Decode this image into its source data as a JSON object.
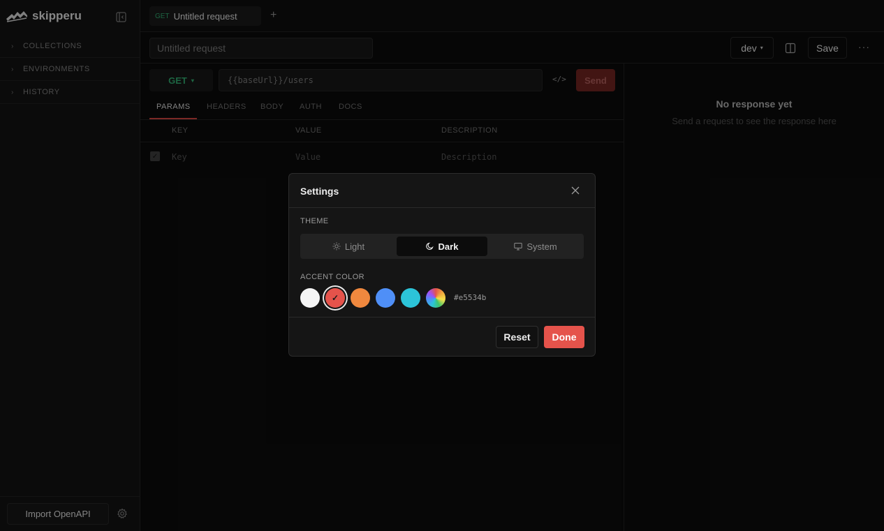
{
  "app": {
    "name": "skipperu"
  },
  "sidebar": {
    "items": [
      {
        "label": "COLLECTIONS"
      },
      {
        "label": "ENVIRONMENTS"
      },
      {
        "label": "HISTORY"
      }
    ],
    "import_label": "Import OpenAPI"
  },
  "tabs": [
    {
      "method": "GET",
      "label": "Untitled request"
    }
  ],
  "add_tab_glyph": "+",
  "request": {
    "name_placeholder": "Untitled request",
    "environment": "dev",
    "save_label": "Save",
    "more_glyph": "···",
    "method": "GET",
    "url_placeholder": "{{baseUrl}}/users",
    "code_glyph": "</>",
    "send_label": "Send"
  },
  "subtabs": [
    {
      "label": "PARAMS",
      "active": true
    },
    {
      "label": "HEADERS"
    },
    {
      "label": "BODY"
    },
    {
      "label": "AUTH"
    },
    {
      "label": "DOCS"
    }
  ],
  "params": {
    "columns": [
      "KEY",
      "VALUE",
      "DESCRIPTION"
    ],
    "placeholders": {
      "key": "Key",
      "value": "Value",
      "description": "Description"
    }
  },
  "response": {
    "title": "No response yet",
    "subtitle": "Send a request to see the response here"
  },
  "settings": {
    "title": "Settings",
    "theme_label": "THEME",
    "theme_options": [
      {
        "label": "Light",
        "icon": "sun-icon"
      },
      {
        "label": "Dark",
        "icon": "moon-icon",
        "active": true
      },
      {
        "label": "System",
        "icon": "monitor-icon"
      }
    ],
    "accent_label": "ACCENT COLOR",
    "accent_colors": [
      "#f5f5f5",
      "#e5534b",
      "#f0883e",
      "#4f8ff7",
      "#2cc4d8",
      "rainbow"
    ],
    "selected_accent": "#e5534b",
    "hex_display": "#e5534b",
    "reset_label": "Reset",
    "done_label": "Done"
  }
}
